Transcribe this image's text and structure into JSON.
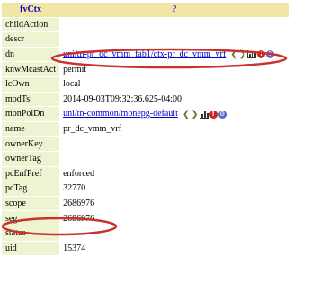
{
  "header": {
    "class_name": "fvCtx",
    "help_label": "?"
  },
  "properties": [
    {
      "name": "childAction",
      "value": ""
    },
    {
      "name": "descr",
      "value": ""
    },
    {
      "name": "dn",
      "value": "uni/tn-pr_dc_vmm_fab1/ctx-pr_dc_vmm_vrf",
      "link": true,
      "icons": true
    },
    {
      "name": "knwMcastAct",
      "value": "permit"
    },
    {
      "name": "lcOwn",
      "value": "local"
    },
    {
      "name": "modTs",
      "value": "2014-09-03T09:32:36.625-04:00"
    },
    {
      "name": "monPolDn",
      "value": "uni/tn-common/monepg-default",
      "link": true,
      "icons": true
    },
    {
      "name": "name",
      "value": "pr_dc_vmm_vrf"
    },
    {
      "name": "ownerKey",
      "value": ""
    },
    {
      "name": "ownerTag",
      "value": ""
    },
    {
      "name": "pcEnfPref",
      "value": "enforced"
    },
    {
      "name": "pcTag",
      "value": "32770"
    },
    {
      "name": "scope",
      "value": "2686976"
    },
    {
      "name": "seg",
      "value": "2686976"
    },
    {
      "name": "status",
      "value": ""
    },
    {
      "name": "uid",
      "value": "15374"
    }
  ],
  "nav_icons": {
    "prev": "left-arrow-icon",
    "next": "right-arrow-icon",
    "stats": "bar-chart-icon",
    "faults": "fault-icon",
    "events": "gear-icon"
  },
  "colors": {
    "header_bg": "#f2e6a6",
    "name_cell_bg": "#eef3d2",
    "link": "#0000cc",
    "annotation": "#c8322a"
  }
}
